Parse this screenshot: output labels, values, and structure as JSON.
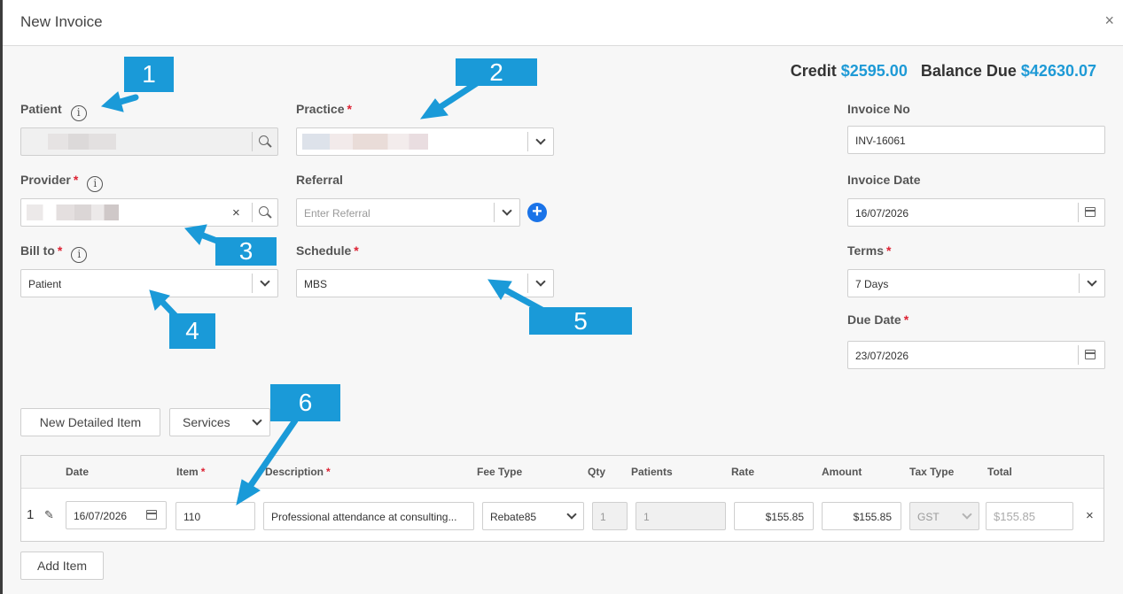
{
  "header": {
    "title": "New Invoice",
    "close": "×"
  },
  "summary": {
    "credit_label": "Credit",
    "credit_value": "$2595.00",
    "balance_label": "Balance Due",
    "balance_value": "$42630.07"
  },
  "form": {
    "patient_label": "Patient",
    "practice_label": "Practice",
    "provider_label": "Provider",
    "referral_label": "Referral",
    "referral_placeholder": "Enter Referral",
    "bill_to_label": "Bill to",
    "bill_to_value": "Patient",
    "schedule_label": "Schedule",
    "schedule_value": "MBS",
    "invoice_no_label": "Invoice No",
    "invoice_no_value": "INV-16061",
    "invoice_date_label": "Invoice Date",
    "invoice_date_value": "16/07/2026",
    "terms_label": "Terms",
    "terms_value": "7 Days",
    "due_date_label": "Due Date",
    "due_date_value": "23/07/2026",
    "required_mark": "*",
    "info_glyph": "i"
  },
  "buttons": {
    "new_detailed_item": "New Detailed Item",
    "services": "Services",
    "add_item": "Add Item"
  },
  "table": {
    "columns": [
      "Date",
      "Item",
      "Description",
      "Fee Type",
      "Qty",
      "Patients",
      "Rate",
      "Amount",
      "Tax Type",
      "Total"
    ],
    "rows": [
      {
        "index": "1",
        "date": "16/07/2026",
        "item": "110",
        "description": "Professional attendance at consulting...",
        "fee_type": "Rebate85",
        "qty": "1",
        "patients": "1",
        "rate": "$155.85",
        "amount": "$155.85",
        "tax_type": "GST",
        "total": "$155.85"
      }
    ]
  },
  "callouts": [
    "1",
    "2",
    "3",
    "4",
    "5",
    "6"
  ],
  "colors": {
    "accent": "#1a9ad8",
    "link_blue": "#1e9ad6",
    "required": "#dd2233"
  },
  "icons": [
    "info-icon",
    "search-icon",
    "chevron-down-icon",
    "clear-icon",
    "plus-circle-icon",
    "calendar-icon",
    "edit-icon",
    "close-icon"
  ]
}
